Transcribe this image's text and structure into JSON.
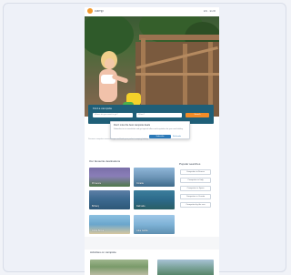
{
  "header": {
    "logo_text": "camp",
    "links": "EN · EUR"
  },
  "hero": {
    "alt": ""
  },
  "search": {
    "title": "Find a campsite",
    "destination_placeholder": "Where do you want to go?",
    "dates_placeholder": "When?",
    "button_label": "Search"
  },
  "popup": {
    "title": "Don't miss the best campsite deals",
    "text": "Subscribe to our newsletter and get special offers and inspiration for your next holiday.",
    "button_label": "Subscribe",
    "link_label": "No thanks"
  },
  "lede": "Discover campsites across Europe and book your perfect camping holiday.",
  "destinations": {
    "title": "Our favourite destinations",
    "tiles": [
      {
        "label": "Provence"
      },
      {
        "label": "Croatia"
      },
      {
        "label": "Brittany"
      },
      {
        "label": "Dalmatia"
      },
      {
        "label": "Costa Brava"
      },
      {
        "label": "Lake Garda"
      }
    ]
  },
  "sidebar": {
    "title": "Popular searches",
    "pills": [
      {
        "label": "Campsites in France"
      },
      {
        "label": "Campsites in Italy"
      },
      {
        "label": "Campsites in Spain"
      },
      {
        "label": "Campsites in Croatia"
      },
      {
        "label": "Campsites by the sea"
      }
    ]
  },
  "camping": {
    "title": "Activities on campsite"
  },
  "colors": {
    "accent": "#f28c28",
    "search_panel": "#1f5f78",
    "link": "#2b79b8"
  }
}
